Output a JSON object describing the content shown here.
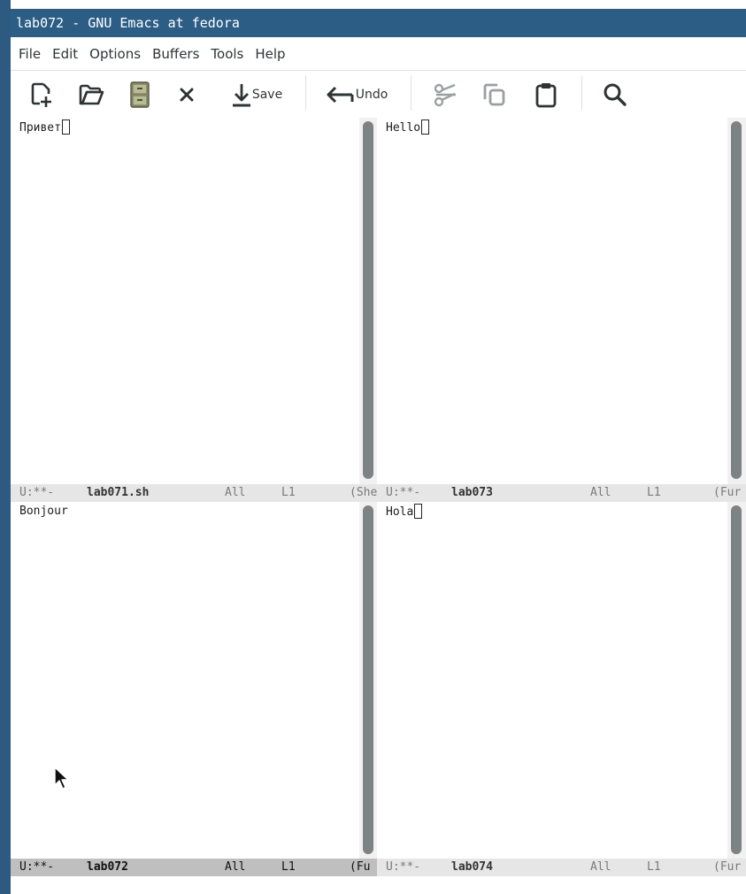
{
  "window": {
    "title": "lab072 - GNU Emacs at fedora"
  },
  "menubar": {
    "items": [
      "File",
      "Edit",
      "Options",
      "Buffers",
      "Tools",
      "Help"
    ]
  },
  "toolbar": {
    "save_label": "Save",
    "undo_label": "Undo",
    "icons": [
      "new-file-icon",
      "open-folder-icon",
      "save-cabinet-icon",
      "close-icon",
      "save-icon",
      "undo-icon",
      "cut-icon",
      "copy-icon",
      "paste-icon",
      "search-icon"
    ]
  },
  "windows": {
    "top_left": {
      "text": "Привет",
      "modeline": {
        "status": "U:**-",
        "buffer": "lab071.sh",
        "position": "All",
        "line": "L1",
        "mode": "(She"
      }
    },
    "top_right": {
      "text": "Hello",
      "modeline": {
        "status": "U:**-",
        "buffer": "lab073",
        "position": "All",
        "line": "L1",
        "mode": "(Fur"
      }
    },
    "bottom_left": {
      "text": "Bonjour",
      "modeline": {
        "status": "U:**-",
        "buffer": "lab072",
        "position": "All",
        "line": "L1",
        "mode": "(Fu"
      }
    },
    "bottom_right": {
      "text": "Hola",
      "modeline": {
        "status": "U:**-",
        "buffer": "lab074",
        "position": "All",
        "line": "L1",
        "mode": "(Fur"
      }
    }
  },
  "active_window": "bottom_left",
  "colors": {
    "titlebar": "#2b5d85",
    "modeline_active": "#bfbfbf",
    "modeline_inactive": "#e6e6e6",
    "scrollbar_thumb": "#7d8384"
  }
}
